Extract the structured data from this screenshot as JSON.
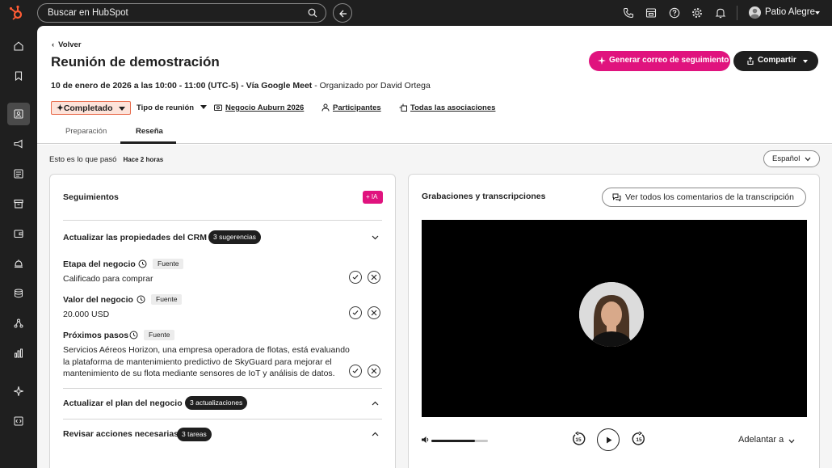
{
  "topbar": {
    "search_placeholder": "Buscar en HubSpot",
    "account_name": "Patio Alegre"
  },
  "page": {
    "back_label": "Volver",
    "title": "Reunión de demostración",
    "generate_btn": "Generar correo de seguimiento",
    "share_btn": "Compartir",
    "meta_date": "10 de enero de 2026 a las 10:00 - 11:00 (UTC-5) - Vía Google Meet",
    "meta_organizer": " - Organizado por David Ortega",
    "status": "Completado",
    "meeting_type": "Tipo de reunión",
    "deal": "Negocio Auburn 2026",
    "participants": "Participantes",
    "associations": "Todas las asociaciones"
  },
  "tabs": [
    {
      "label": "Preparación"
    },
    {
      "label": "Reseña"
    }
  ],
  "summary": {
    "text": "Esto es lo que pasó",
    "since": "Hace 2 horas",
    "language": "Español"
  },
  "followups": {
    "title": "Seguimientos",
    "ai_badge": "IA",
    "crm_section": "Actualizar las propiedades del CRM",
    "crm_pill": "3 sugerencias",
    "source_tag": "Fuente",
    "fields": [
      {
        "label": "Etapa del negocio",
        "value": "Calificado para comprar"
      },
      {
        "label": "Valor del negocio",
        "value": "20.000 USD"
      },
      {
        "label": "Próximos pasos",
        "value": "Servicios Aéreos Horizon, una empresa operadora de flotas, está evaluando la plataforma de mantenimiento predictivo de SkyGuard para mejorar el mantenimiento de su flota mediante sensores de IoT y análisis de datos."
      }
    ],
    "plan_section": "Actualizar el plan del negocio",
    "plan_pill": "3 actualizaciones",
    "actions_section": "Revisar acciones necesarias",
    "actions_pill": "3 tareas"
  },
  "recordings": {
    "title": "Grabaciones y transcripciones",
    "comments_btn": "Ver todos los comentarios de la transcripción",
    "skip_seconds": "15",
    "forward_label": "Adelantar a"
  },
  "colors": {
    "accent": "#e0137e",
    "status_bg": "#fde3da",
    "status_border": "#e76b4c",
    "dark": "#1f1f1f"
  }
}
